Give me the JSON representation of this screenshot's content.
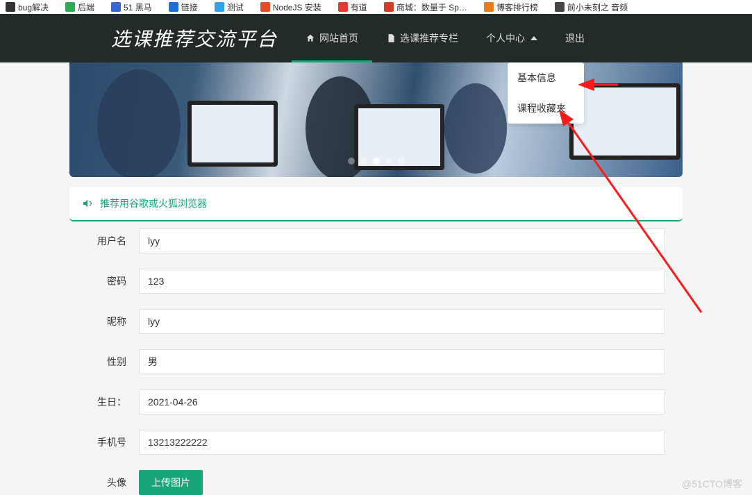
{
  "bookmarks": [
    {
      "label": "bug解决",
      "color": "#333"
    },
    {
      "label": "后端",
      "color": "#2eaa56"
    },
    {
      "label": "51 黑马",
      "color": "#3a66d1"
    },
    {
      "label": "链接",
      "color": "#1e6fd9"
    },
    {
      "label": "测试",
      "color": "#33a0e8"
    },
    {
      "label": "NodeJS 安装",
      "color": "#e44d26"
    },
    {
      "label": "有道",
      "color": "#e53935"
    },
    {
      "label": "商城：数量于 Sp…",
      "color": "#d23c2a"
    },
    {
      "label": "博客排行榜",
      "color": "#e67e22"
    },
    {
      "label": "前小未刻之 音频",
      "color": "#444"
    }
  ],
  "site_title": "选课推荐交流平台",
  "nav": {
    "home": "网站首页",
    "column": "选课推荐专栏",
    "personal": "个人中心",
    "logout": "退出"
  },
  "dropdown": {
    "item1": "基本信息",
    "item2": "课程收藏夹"
  },
  "notice": "推荐用谷歌或火狐浏览器",
  "form": {
    "username_label": "用户名",
    "username_value": "lyy",
    "password_label": "密码",
    "password_value": "123",
    "nickname_label": "昵称",
    "nickname_value": "lyy",
    "gender_label": "性别",
    "gender_value": "男",
    "birthday_label": "生日：",
    "birthday_value": "2021-04-26",
    "phone_label": "手机号",
    "phone_value": "13213222222",
    "avatar_label": "头像",
    "upload_btn": "上传图片"
  },
  "watermark": "@51CTO博客"
}
